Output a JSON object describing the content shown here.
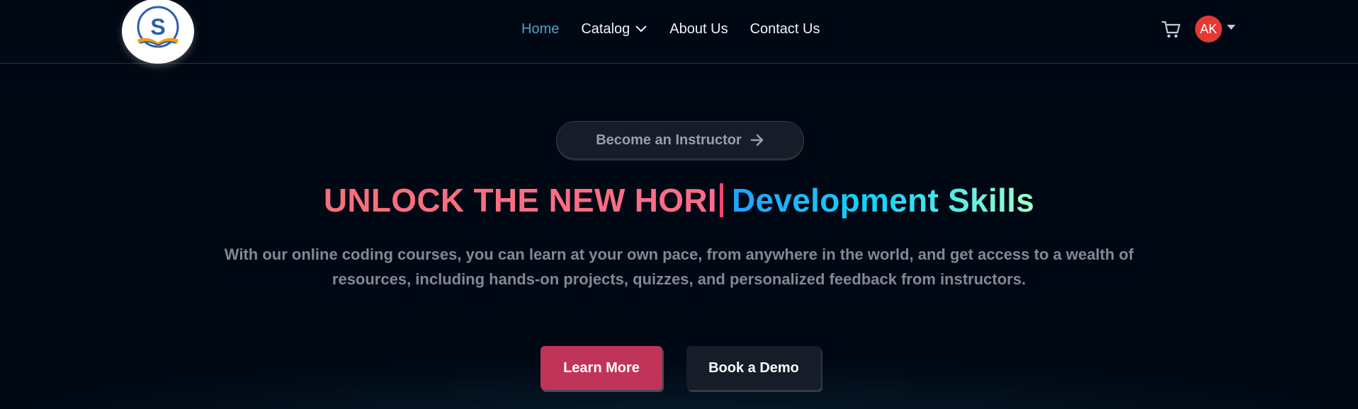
{
  "navbar": {
    "logo_letter": "S",
    "links": [
      {
        "label": "Home",
        "active": true
      },
      {
        "label": "Catalog",
        "has_dropdown": true
      },
      {
        "label": "About Us"
      },
      {
        "label": "Contact Us"
      }
    ],
    "cart_icon": "cart-icon",
    "avatar_initials": "AK",
    "avatar_color": "#e53935"
  },
  "hero": {
    "instructor_button": "Become an Instructor",
    "headline_typed": "UNLOCK THE NEW HORI",
    "headline_highlight": "Development Skills",
    "description": "With our online coding courses, you can learn at your own pace, from anywhere in the world, and get access to a wealth of resources, including hands-on projects, quizzes, and personalized feedback from instructors.",
    "primary_button": "Learn More",
    "secondary_button": "Book a Demo"
  },
  "colors": {
    "background": "#000814",
    "accent_active_link": "#47a5c5",
    "primary_button": "#c0345a",
    "headline_pink": "#ef476f",
    "headline_cyan": "#12d8fa"
  }
}
